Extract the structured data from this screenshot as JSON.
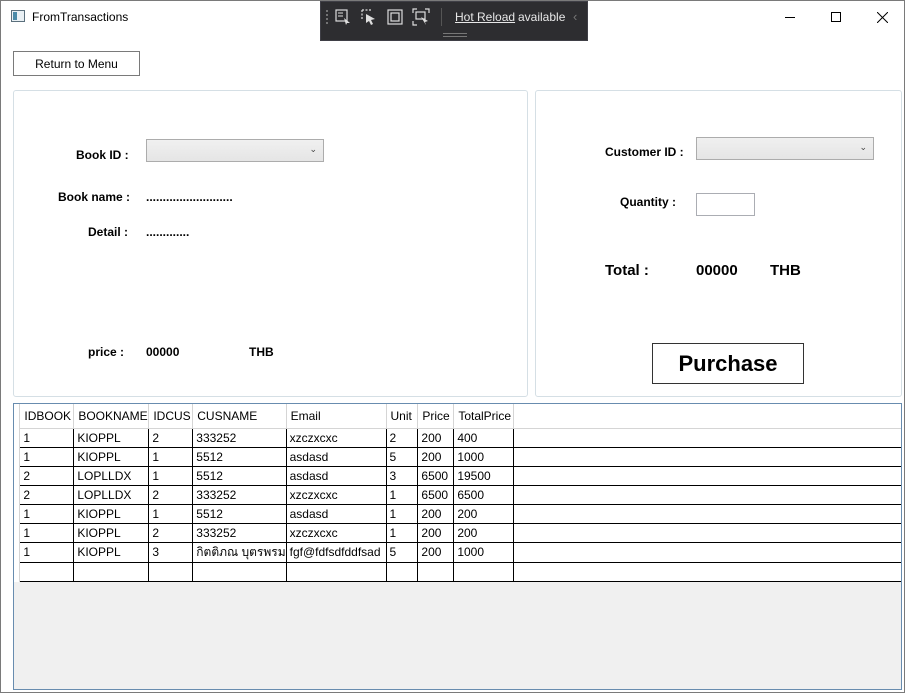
{
  "window": {
    "title": "FromTransactions"
  },
  "hot_reload": {
    "link": "Hot Reload",
    "status": "available",
    "chevron": "‹"
  },
  "toolbar": {
    "return_label": "Return to Menu"
  },
  "book": {
    "id_label": "Book ID :",
    "id_value": "",
    "name_label": "Book name :",
    "name_value": "..........................",
    "detail_label": "Detail :",
    "detail_value": ".............",
    "price_label": "price :",
    "price_value": "00000",
    "price_unit": "THB"
  },
  "customer": {
    "id_label": "Customer ID :",
    "id_value": "",
    "quantity_label": "Quantity :",
    "quantity_value": "",
    "total_label": "Total :",
    "total_value": "00000",
    "total_unit": "THB",
    "purchase_label": "Purchase"
  },
  "table": {
    "columns": [
      "IDBOOK",
      "BOOKNAME",
      "IDCUS",
      "CUSNAME",
      "Email",
      "Unit",
      "Price",
      "TotalPrice"
    ],
    "rows": [
      [
        "1",
        "KIOPPL",
        "2",
        "333252",
        "xzczxcxc",
        "2",
        "200",
        "400"
      ],
      [
        "1",
        "KIOPPL",
        "1",
        "5512",
        "asdasd",
        "5",
        "200",
        "1000"
      ],
      [
        "2",
        "LOPLLDX",
        "1",
        "5512",
        "asdasd",
        "3",
        "6500",
        "19500"
      ],
      [
        "2",
        "LOPLLDX",
        "2",
        "333252",
        "xzczxcxc",
        "1",
        "6500",
        "6500"
      ],
      [
        "1",
        "KIOPPL",
        "1",
        "5512",
        "asdasd",
        "1",
        "200",
        "200"
      ],
      [
        "1",
        "KIOPPL",
        "2",
        "333252",
        "xzczxcxc",
        "1",
        "200",
        "200"
      ],
      [
        "1",
        "KIOPPL",
        "3",
        "กิตติภณ บุตรพรม",
        "fgf@fdfsdfddfsad",
        "5",
        "200",
        "1000"
      ]
    ]
  },
  "icons": {
    "app": "window-app-icon",
    "minimize": "minimize-icon",
    "maximize": "maximize-icon",
    "close": "close-icon",
    "dropdown": "chevron-down-icon"
  }
}
